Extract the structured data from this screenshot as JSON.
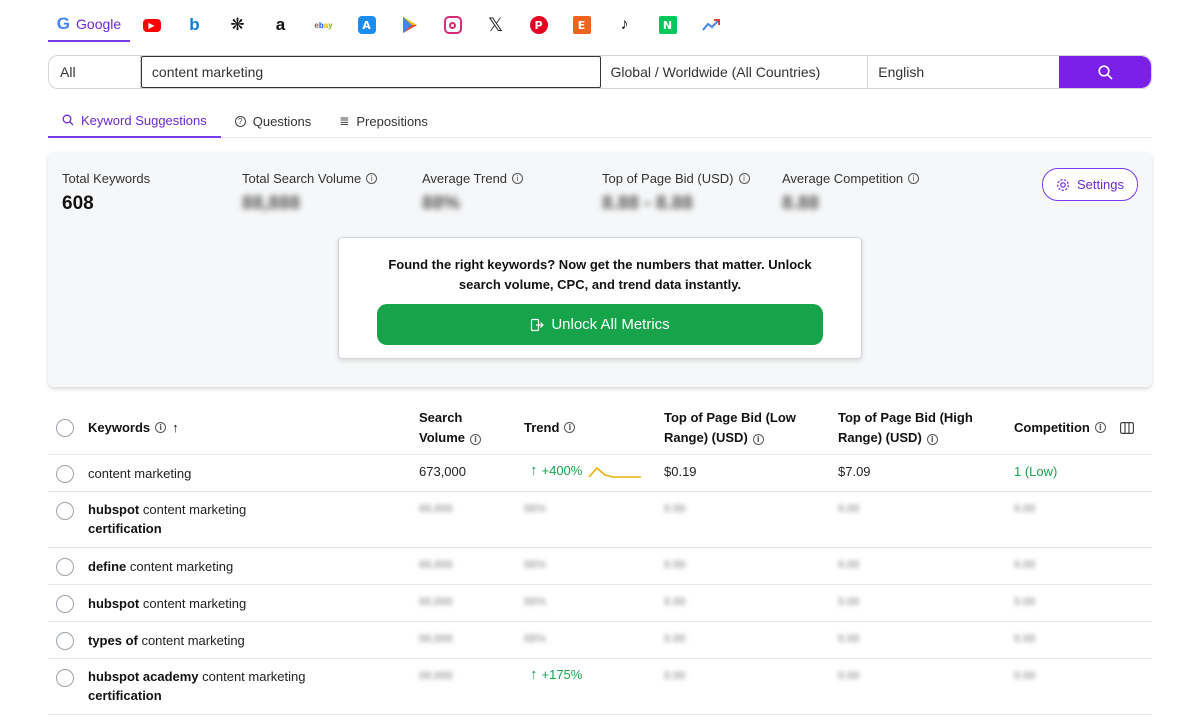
{
  "engines": {
    "google_label": "Google",
    "icons": [
      "youtube-icon",
      "bing-icon",
      "perplexity-icon",
      "amazon-icon",
      "ebay-icon",
      "app-store-icon",
      "google-play-icon",
      "instagram-icon",
      "x-icon",
      "pinterest-icon",
      "etsy-icon",
      "tiktok-icon",
      "naver-icon",
      "trends-icon"
    ]
  },
  "search": {
    "scope": "All",
    "query": "content marketing",
    "location": "Global / Worldwide (All Countries)",
    "language": "English"
  },
  "subtabs": {
    "suggestions": "Keyword Suggestions",
    "questions": "Questions",
    "prepositions": "Prepositions"
  },
  "stats": {
    "total_keywords_label": "Total Keywords",
    "total_keywords_value": "608",
    "total_volume_label": "Total Search Volume",
    "total_volume_value": "88,888",
    "avg_trend_label": "Average Trend",
    "avg_trend_value": "88%",
    "bid_label": "Top of Page Bid (USD)",
    "bid_value": "8.88 - 8.88",
    "competition_label": "Average Competition",
    "competition_value": "8.88",
    "settings_label": "Settings"
  },
  "unlock": {
    "message": "Found the right keywords? Now get the numbers that matter. Unlock search volume, CPC, and trend data instantly.",
    "button": "Unlock All Metrics"
  },
  "table": {
    "headers": {
      "keywords": "Keywords",
      "search_volume": "Search Volume",
      "trend": "Trend",
      "bid_low": "Top of Page Bid (Low Range) (USD)",
      "bid_high": "Top of Page Bid (High Range) (USD)",
      "competition": "Competition"
    },
    "rows": [
      {
        "bold": "",
        "rest": "content marketing",
        "bold2": "",
        "volume": "673,000",
        "trend": "+400%",
        "low": "$0.19",
        "high": "$7.09",
        "competition": "1 (Low)"
      },
      {
        "bold": "hubspot",
        "rest": " content marketing",
        "bold2": "certification",
        "volume": "88,888",
        "trend": "88%",
        "low": "8.88",
        "high": "8.88",
        "competition": "8.88"
      },
      {
        "bold": "define",
        "rest": " content marketing",
        "bold2": "",
        "volume": "88,888",
        "trend": "88%",
        "low": "8.88",
        "high": "8.88",
        "competition": "8.88"
      },
      {
        "bold": "hubspot",
        "rest": " content marketing",
        "bold2": "",
        "volume": "88,888",
        "trend": "88%",
        "low": "8.88",
        "high": "8.88",
        "competition": "8.88"
      },
      {
        "bold": "types of",
        "rest": " content marketing",
        "bold2": "",
        "volume": "88,888",
        "trend": "88%",
        "low": "8.88",
        "high": "8.88",
        "competition": "8.88"
      },
      {
        "bold": "hubspot academy",
        "rest": " content marketing",
        "bold2": "certification",
        "volume": "88,888",
        "trend": "+175%",
        "low": "8.88",
        "high": "8.88",
        "competition": "8.88"
      }
    ]
  }
}
